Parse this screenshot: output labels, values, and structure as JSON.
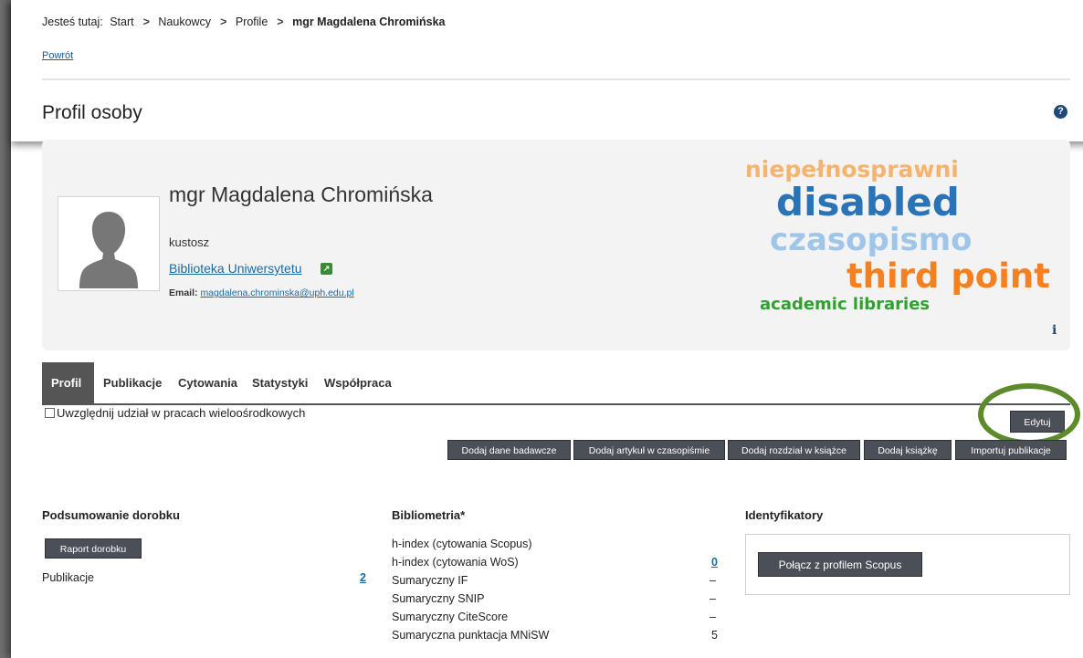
{
  "breadcrumb": {
    "prefix": "Jesteś tutaj:",
    "items": [
      "Start",
      "Naukowcy",
      "Profile"
    ],
    "current": "mgr Magdalena Chromińska",
    "separator": ">"
  },
  "back_link": "Powrót",
  "page_title": "Profil osoby",
  "help_icon_glyph": "?",
  "profile": {
    "name": "mgr Magdalena Chromińska",
    "role": "kustosz",
    "unit": "Biblioteka Uniwersytetu",
    "email_label": "Email:",
    "email": "magdalena.chrominska@uph.edu.pl"
  },
  "word_cloud": [
    "niepełnosprawni",
    "disabled",
    "czasopismo",
    "third point",
    "academic libraries"
  ],
  "word_cloud_colors": [
    "#f7b36b",
    "#2a73b6",
    "#9fc5e8",
    "#f4801f",
    "#2fa12f"
  ],
  "info_glyph": "i",
  "tabs": [
    "Profil",
    "Publikacje",
    "Cytowania",
    "Statystyki",
    "Współpraca"
  ],
  "checkbox_label": "Uwzględnij udział w pracach wieloośrodkowych",
  "edit_button": "Edytuj",
  "action_buttons": [
    "Dodaj dane badawcze",
    "Dodaj artykuł w czasopiśmie",
    "Dodaj rozdział w książce",
    "Dodaj książkę",
    "Importuj publikacje"
  ],
  "summary": {
    "heading": "Podsumowanie dorobku",
    "report_button": "Raport dorobku",
    "publications_label": "Publikacje",
    "publications_count": "2"
  },
  "bibliometrics": {
    "heading": "Bibliometria*",
    "rows": [
      {
        "label": "h-index (cytowania Scopus)",
        "value": ""
      },
      {
        "label": "h-index (cytowania WoS)",
        "value": "0"
      },
      {
        "label": "Sumaryczny IF",
        "value": "–"
      },
      {
        "label": "Sumaryczny SNIP",
        "value": "–"
      },
      {
        "label": "Sumaryczny CiteScore",
        "value": "–"
      },
      {
        "label": "Sumaryczna punktacja MNiSW",
        "value": "5"
      }
    ]
  },
  "identifiers": {
    "heading": "Identyfikatory",
    "scopus_button": "Połącz z profilem Scopus"
  }
}
